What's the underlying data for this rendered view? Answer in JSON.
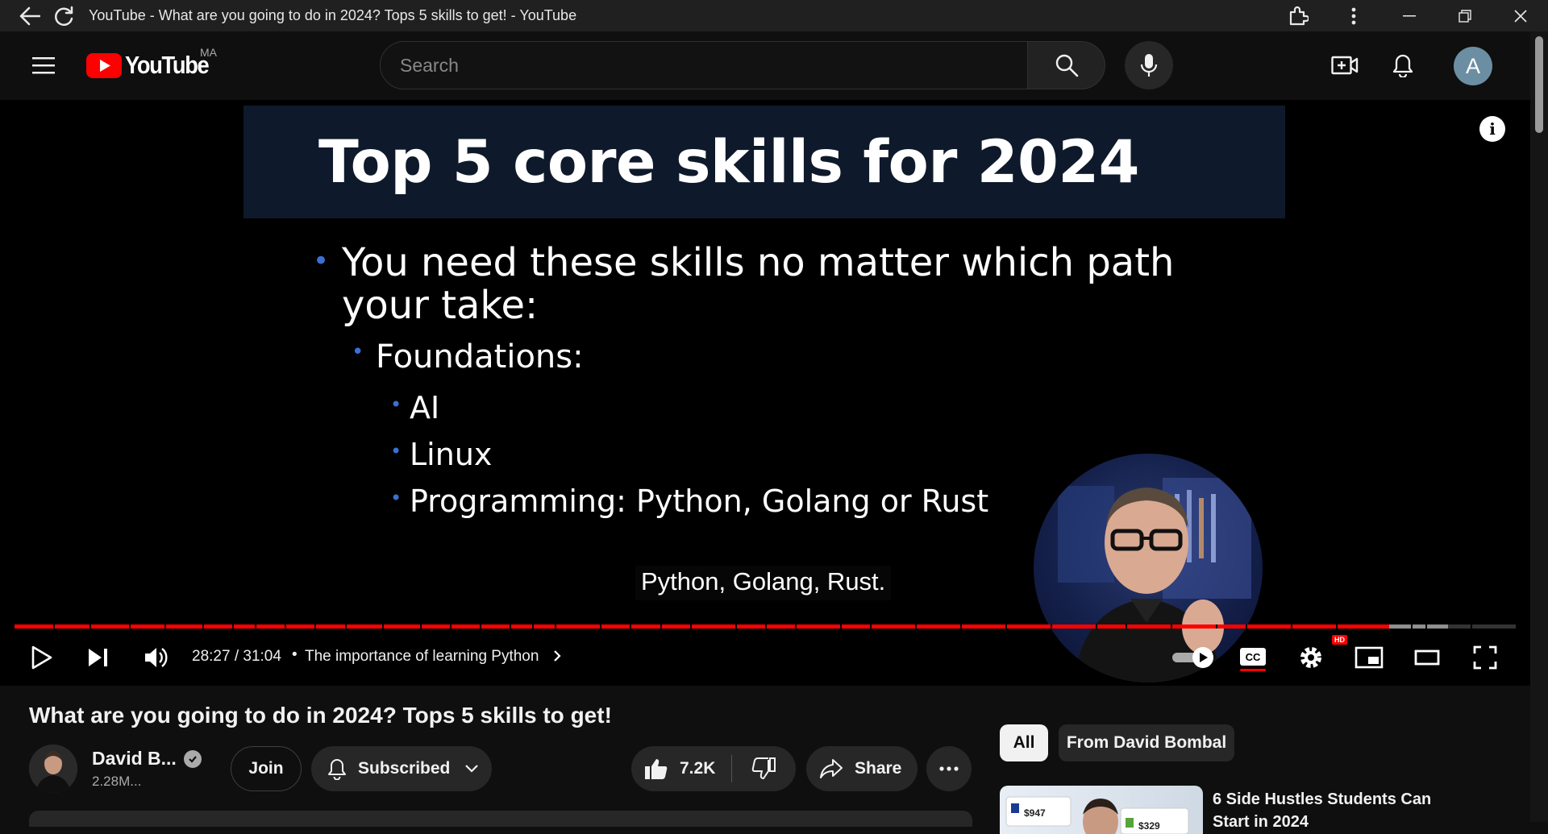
{
  "window": {
    "title": "YouTube - What are you going to do in 2024? Tops 5 skills to get! - YouTube"
  },
  "masthead": {
    "logo_text": "YouTube",
    "country_code": "MA",
    "search_placeholder": "Search",
    "avatar_letter": "A"
  },
  "player": {
    "slide_title": "Top 5 core skills for 2024",
    "bullets": [
      "You need these skills no matter which path your take:",
      "Foundations:",
      "AI",
      "Linux",
      "Programming: Python, Golang or Rust"
    ],
    "caption": "Python, Golang, Rust.",
    "info_glyph": "i",
    "time": "28:27 / 31:04",
    "chapter_separator": "•",
    "chapter": "The importance of learning Python",
    "progress_played_fraction": 0.9157,
    "progress_loaded_fraction": 0.955,
    "hd_badge": "HD",
    "cc_label": "CC"
  },
  "video": {
    "title": "What are you going to do in 2024? Tops 5 skills to get!",
    "channel_name": "David B...",
    "subscribers": "2.28M...",
    "join_label": "Join",
    "subscribed_label": "Subscribed",
    "likes": "7.2K",
    "share_label": "Share"
  },
  "sidebar": {
    "chips": [
      "All",
      "From David Bombal"
    ],
    "recommendation_title": "6 Side Hustles Students Can Start in 2024",
    "thumb_values": [
      "$947",
      "$329"
    ]
  },
  "colors": {
    "accent_red": "#ff0000",
    "background": "#0f0f0f",
    "bullet_blue": "#3b6fd3"
  }
}
